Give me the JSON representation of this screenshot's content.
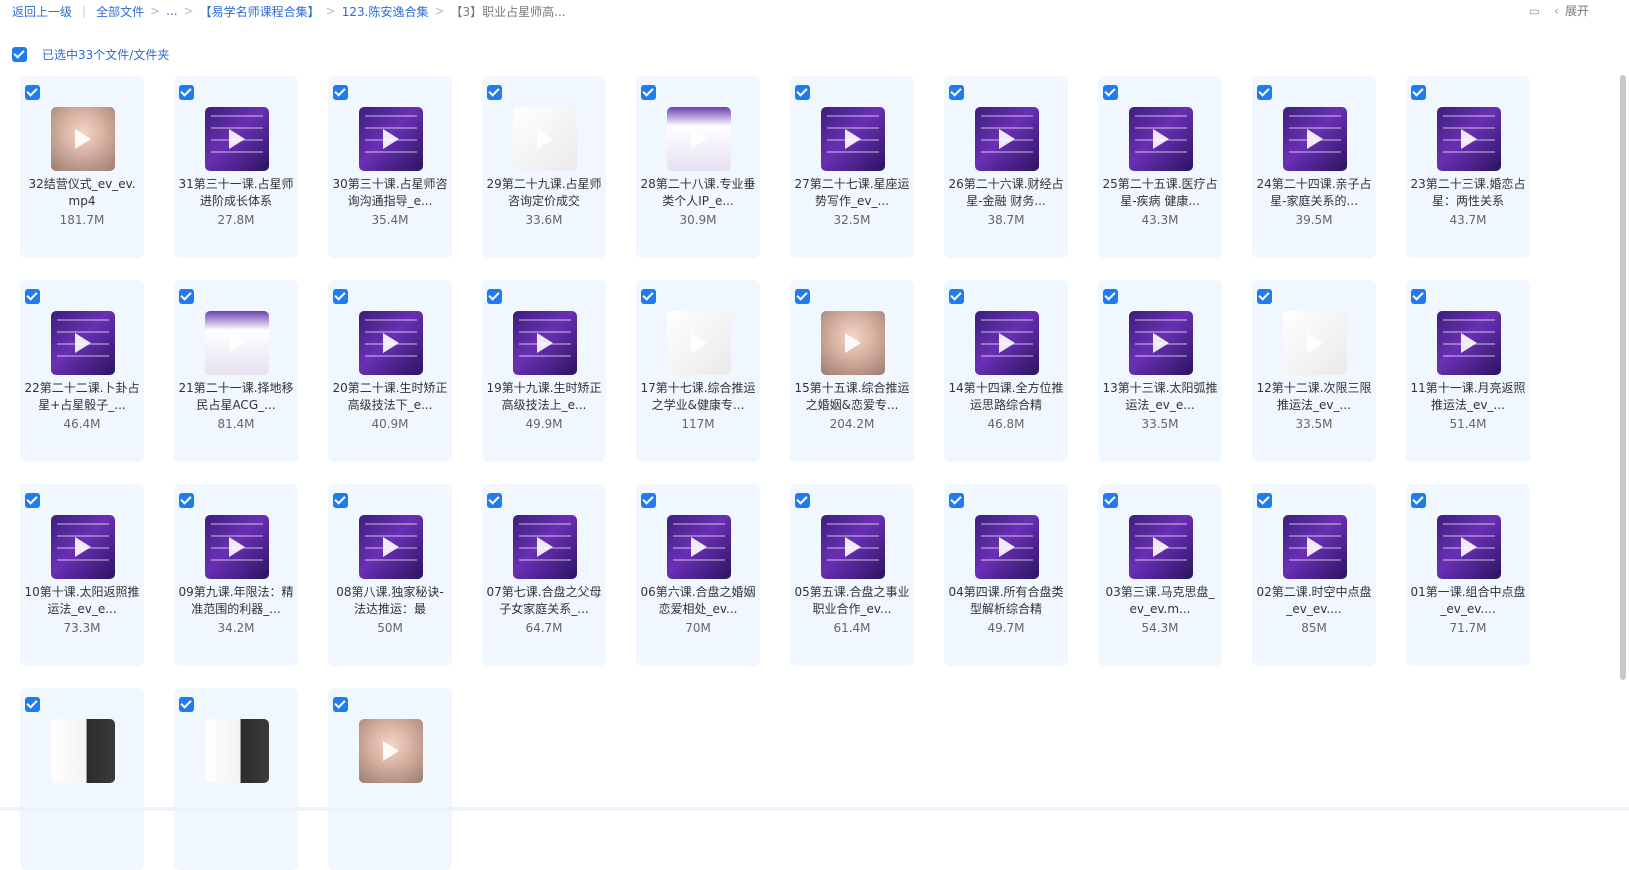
{
  "breadcrumb": {
    "back": "返回上一级",
    "items": [
      "全部文件",
      "...",
      "【易学名师课程合集】",
      "123.陈安逸合集",
      "【3】职业占星师高..."
    ]
  },
  "topright": {
    "expand_label": "展开",
    "view_icon": "list-view-icon",
    "collapse_icon": "chevron-left-icon"
  },
  "selection": {
    "text": "已选中33个文件/文件夹",
    "checked": true
  },
  "files": [
    {
      "name": "32结营仪式_ev_ev.mp4",
      "size": "181.7M",
      "thumb": "face"
    },
    {
      "name": "31第三十一课.占星师进阶成长体系",
      "size": "27.8M",
      "thumb": "purple"
    },
    {
      "name": "30第三十课.占星师咨询沟通指导_e...",
      "size": "35.4M",
      "thumb": "purple"
    },
    {
      "name": "29第二十九课.占星师咨询定价成交",
      "size": "33.6M",
      "thumb": "light"
    },
    {
      "name": "28第二十八课.专业垂类个人IP_e...",
      "size": "30.9M",
      "thumb": "chart"
    },
    {
      "name": "27第二十七课.星座运势写作_ev_...",
      "size": "32.5M",
      "thumb": "purple"
    },
    {
      "name": "26第二十六课.财经占星-金融 财务...",
      "size": "38.7M",
      "thumb": "purple"
    },
    {
      "name": "25第二十五课.医疗占星-疾病 健康...",
      "size": "43.3M",
      "thumb": "purple"
    },
    {
      "name": "24第二十四课.亲子占星-家庭关系的...",
      "size": "39.5M",
      "thumb": "purple"
    },
    {
      "name": "23第二十三课.婚恋占星：两性关系",
      "size": "43.7M",
      "thumb": "purple"
    },
    {
      "name": "22第二十二课.卜卦占星+占星骰子_...",
      "size": "46.4M",
      "thumb": "purple"
    },
    {
      "name": "21第二十一课.择地移民占星ACG_...",
      "size": "81.4M",
      "thumb": "chart"
    },
    {
      "name": "20第二十课.生时矫正高级技法下_e...",
      "size": "40.9M",
      "thumb": "purple"
    },
    {
      "name": "19第十九课.生时矫正高级技法上_e...",
      "size": "49.9M",
      "thumb": "purple"
    },
    {
      "name": "17第十七课.综合推运之学业&健康专...",
      "size": "117M",
      "thumb": "light"
    },
    {
      "name": "15第十五课.综合推运之婚姻&恋爱专...",
      "size": "204.2M",
      "thumb": "face"
    },
    {
      "name": "14第十四课.全方位推运思路综合精",
      "size": "46.8M",
      "thumb": "purple"
    },
    {
      "name": "13第十三课.太阳弧推运法_ev_e...",
      "size": "33.5M",
      "thumb": "purple"
    },
    {
      "name": "12第十二课.次限三限推运法_ev_...",
      "size": "33.5M",
      "thumb": "light"
    },
    {
      "name": "11第十一课.月亮返照推运法_ev_...",
      "size": "51.4M",
      "thumb": "purple"
    },
    {
      "name": "10第十课.太阳返照推运法_ev_e...",
      "size": "73.3M",
      "thumb": "purple"
    },
    {
      "name": "09第九课.年限法：精准范围的利器_...",
      "size": "34.2M",
      "thumb": "purple"
    },
    {
      "name": "08第八课.独家秘诀-法达推运：最",
      "size": "50M",
      "thumb": "purple"
    },
    {
      "name": "07第七课.合盘之父母子女家庭关系_...",
      "size": "64.7M",
      "thumb": "purple"
    },
    {
      "name": "06第六课.合盘之婚姻恋爱相处_ev...",
      "size": "70M",
      "thumb": "purple"
    },
    {
      "name": "05第五课.合盘之事业职业合作_ev...",
      "size": "61.4M",
      "thumb": "purple"
    },
    {
      "name": "04第四课.所有合盘类型解析综合精",
      "size": "49.7M",
      "thumb": "purple"
    },
    {
      "name": "03第三课.马克思盘_ev_ev.m...",
      "size": "54.3M",
      "thumb": "purple"
    },
    {
      "name": "02第二课.时空中点盘_ev_ev....",
      "size": "85M",
      "thumb": "purple"
    },
    {
      "name": "01第一课.组合中点盘_ev_ev....",
      "size": "71.7M",
      "thumb": "purple"
    },
    {
      "name": "",
      "size": "",
      "thumb": "doc"
    },
    {
      "name": "",
      "size": "",
      "thumb": "doc"
    },
    {
      "name": "",
      "size": "",
      "thumb": "face"
    }
  ]
}
